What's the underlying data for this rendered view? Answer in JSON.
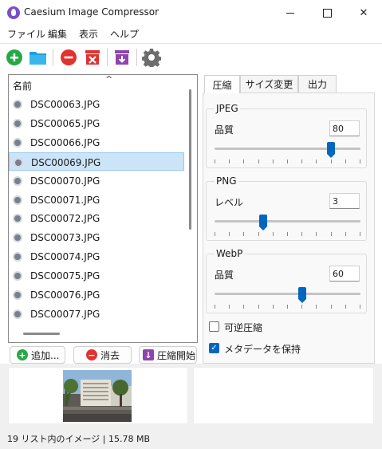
{
  "window": {
    "title": "Caesium Image Compressor"
  },
  "menu": [
    "ファイル",
    "編集",
    "表示",
    "ヘルプ"
  ],
  "toolbar": {
    "icons": [
      "add-icon",
      "open-folder-icon",
      "remove-icon",
      "clear-list-icon",
      "compress-icon",
      "settings-icon"
    ],
    "colors": {
      "green": "#28a745",
      "blue": "#1ba1e2",
      "red": "#e0322f",
      "purple": "#8e44ad",
      "gray": "#6d6d6d"
    }
  },
  "list": {
    "header": "名前",
    "files": [
      "DSC00063.JPG",
      "DSC00065.JPG",
      "DSC00066.JPG",
      "DSC00069.JPG",
      "DSC00070.JPG",
      "DSC00071.JPG",
      "DSC00072.JPG",
      "DSC00073.JPG",
      "DSC00074.JPG",
      "DSC00075.JPG",
      "DSC00076.JPG",
      "DSC00077.JPG"
    ],
    "selected_index": 3
  },
  "actions": {
    "add": "追加...",
    "remove": "消去",
    "compress": "圧縮開始"
  },
  "tabs": [
    "圧縮",
    "サイズ変更",
    "出力"
  ],
  "settings": {
    "jpeg": {
      "title": "JPEG",
      "label": "品質",
      "value": "80",
      "level": 0.8
    },
    "png": {
      "title": "PNG",
      "label": "レベル",
      "value": "3",
      "level": 0.333
    },
    "webp": {
      "title": "WebP",
      "label": "品質",
      "value": "60",
      "level": 0.6
    },
    "lossless": {
      "label": "可逆圧縮",
      "checked": false
    },
    "keep_metadata": {
      "label": "メタデータを保持",
      "checked": true
    },
    "checkmark": "✓"
  },
  "status": {
    "text": "19 リスト内のイメージ | 15.78 MB"
  },
  "accent_color": "#0067c0"
}
